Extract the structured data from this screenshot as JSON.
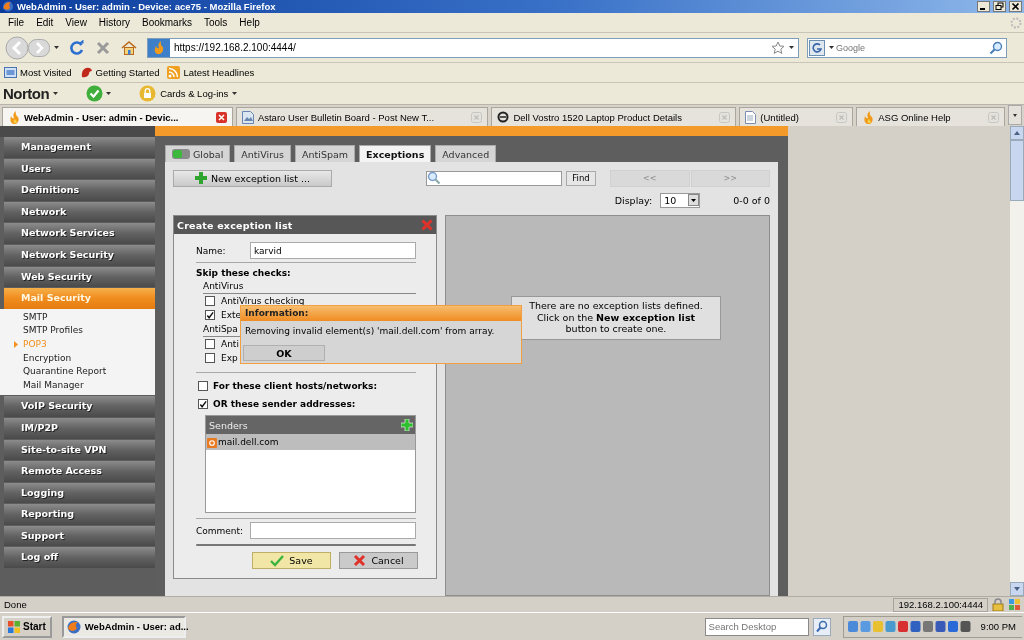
{
  "window": {
    "title": "WebAdmin - User: admin - Device: ace75 - Mozilla Firefox"
  },
  "menu": [
    "File",
    "Edit",
    "View",
    "History",
    "Bookmarks",
    "Tools",
    "Help"
  ],
  "address_bar": {
    "url": "https://192.168.2.100:4444/"
  },
  "web_search": {
    "placeholder": "Google"
  },
  "bookmarks": [
    "Most Visited",
    "Getting Started",
    "Latest Headlines"
  ],
  "norton_toolbar": {
    "brand": "Norton",
    "menu": "Cards & Log-ins"
  },
  "browser_tabs": [
    {
      "title": "WebAdmin - User: admin - Devic...",
      "selected": true
    },
    {
      "title": "Astaro User Bulletin Board - Post New T...",
      "selected": false
    },
    {
      "title": "Dell Vostro 1520 Laptop Product Details",
      "selected": false
    },
    {
      "title": "(Untitled)",
      "selected": false
    },
    {
      "title": "ASG Online Help",
      "selected": false
    }
  ],
  "sidebar": {
    "items": [
      {
        "label": "Management",
        "selected": false
      },
      {
        "label": "Users",
        "selected": false
      },
      {
        "label": "Definitions",
        "selected": false
      },
      {
        "label": "Network",
        "selected": false
      },
      {
        "label": "Network Services",
        "selected": false
      },
      {
        "label": "Network Security",
        "selected": false
      },
      {
        "label": "Web Security",
        "selected": false
      },
      {
        "label": "Mail Security",
        "selected": true,
        "children": [
          {
            "label": "SMTP",
            "selected": false
          },
          {
            "label": "SMTP Profiles",
            "selected": false
          },
          {
            "label": "POP3",
            "selected": true
          },
          {
            "label": "Encryption",
            "selected": false
          },
          {
            "label": "Quarantine Report",
            "selected": false
          },
          {
            "label": "Mail Manager",
            "selected": false
          }
        ]
      },
      {
        "label": "VoIP Security",
        "selected": false
      },
      {
        "label": "IM/P2P",
        "selected": false
      },
      {
        "label": "Site-to-site VPN",
        "selected": false
      },
      {
        "label": "Remote Access",
        "selected": false
      },
      {
        "label": "Logging",
        "selected": false
      },
      {
        "label": "Reporting",
        "selected": false
      },
      {
        "label": "Support",
        "selected": false
      },
      {
        "label": "Log off",
        "selected": false
      }
    ]
  },
  "tabs": [
    {
      "label": "Global",
      "selected": false
    },
    {
      "label": "AntiVirus",
      "selected": false
    },
    {
      "label": "AntiSpam",
      "selected": false
    },
    {
      "label": "Exceptions",
      "selected": true
    },
    {
      "label": "Advanced",
      "selected": false
    }
  ],
  "toolbar": {
    "new_button": "New exception list ...",
    "find_button": "Find",
    "pager": [
      {
        "label": "<<",
        "disabled": true
      },
      {
        "label": ">>",
        "disabled": true
      }
    ],
    "display_label": "Display:",
    "display_value": "10",
    "count": "0-0 of 0"
  },
  "dialog": {
    "title": "Create exception list",
    "name_label": "Name:",
    "name_value": "karvid",
    "skip_heading": "Skip these checks:",
    "groups": [
      {
        "heading": "AntiVirus",
        "checks": [
          {
            "label": "AntiVirus checking",
            "checked": false
          },
          {
            "label": "Exte",
            "checked": true
          }
        ]
      },
      {
        "heading": "AntiSpa",
        "checks": [
          {
            "label": "Anti",
            "checked": false
          },
          {
            "label": "Exp",
            "checked": false
          }
        ]
      }
    ],
    "conditions": [
      {
        "label": "For these client hosts/networks:",
        "checked": false
      },
      {
        "label": "OR these sender addresses:",
        "checked": true
      }
    ],
    "senders": {
      "heading": "Senders",
      "rows": [
        {
          "address": "mail.dell.com",
          "selected": true
        }
      ]
    },
    "comment_label": "Comment:",
    "buttons": [
      {
        "label": "Save",
        "kind": "save"
      },
      {
        "label": "Cancel",
        "kind": "cancel"
      }
    ]
  },
  "empty_message": "There are no exception lists defined. Click on the **New exception list** button to create one.",
  "info_popup": {
    "title": "Information:",
    "message": "Removing invalid element(s) 'mail.dell.com' from array.",
    "button": "OK"
  },
  "status_bar": {
    "text": "Done",
    "host": "192.168.2.100:4444"
  },
  "taskbar": {
    "start": "Start",
    "tasks": [
      {
        "label": "WebAdmin - User: ad...",
        "selected": true
      }
    ],
    "search": {
      "placeholder": "Search Desktop"
    },
    "clock": "9:00 PM"
  }
}
